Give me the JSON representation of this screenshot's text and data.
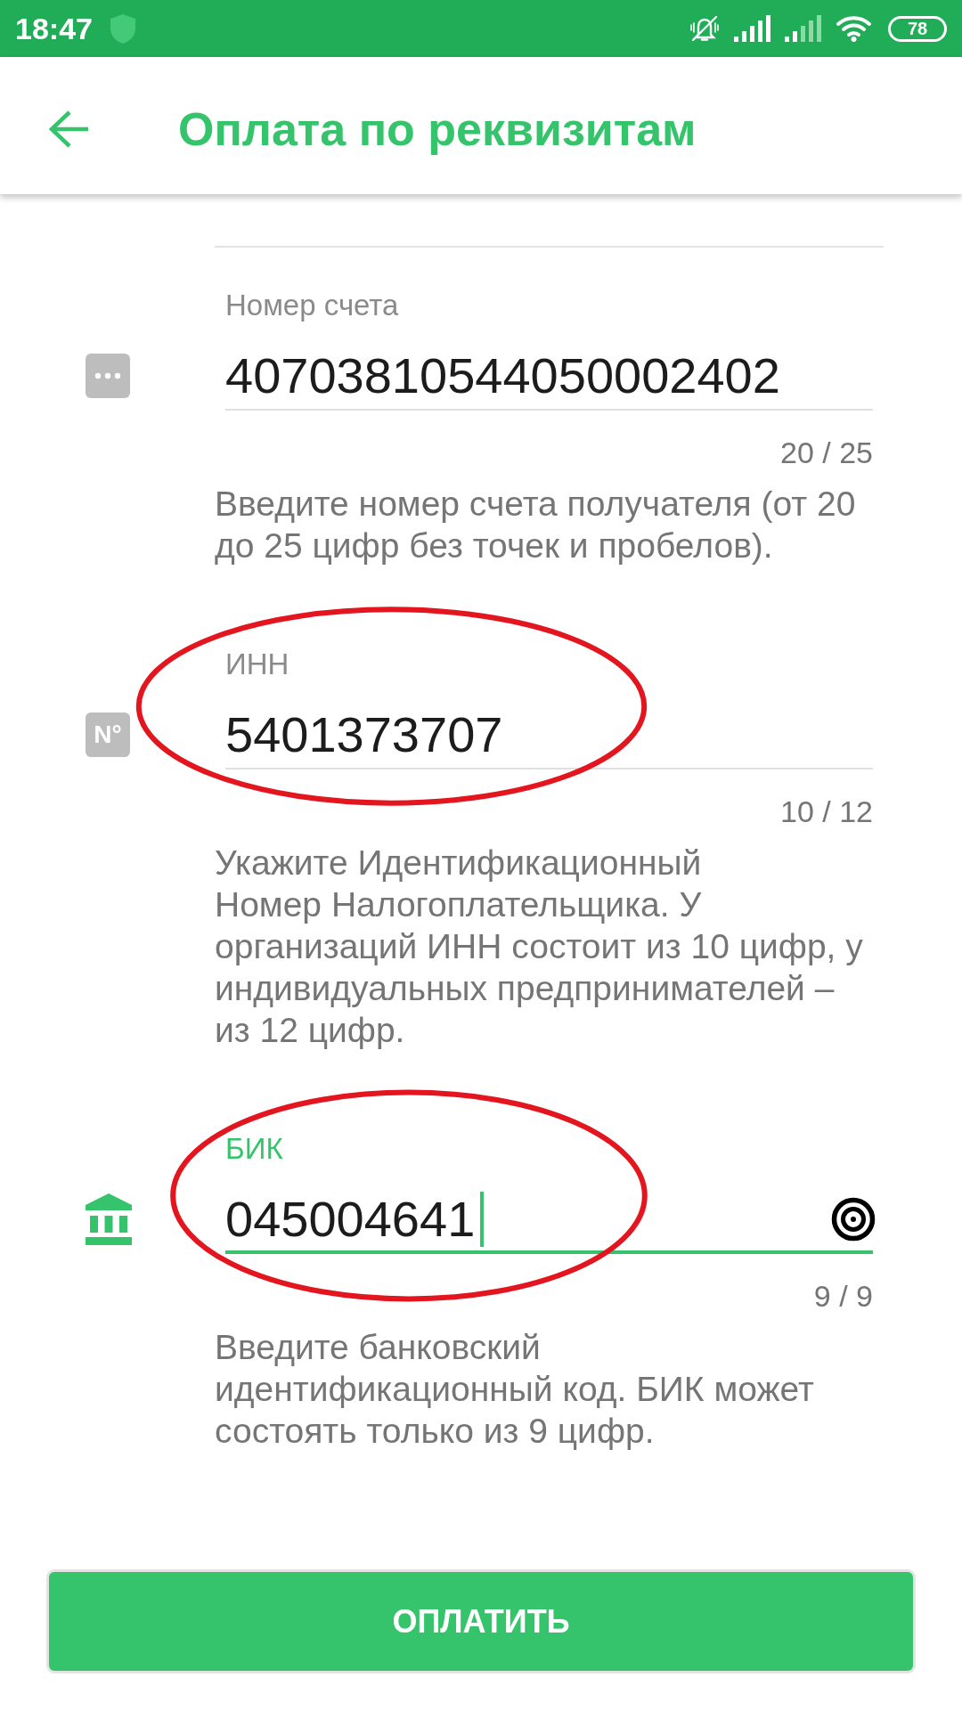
{
  "status_bar": {
    "time": "18:47",
    "battery": "78"
  },
  "header": {
    "title": "Оплата по реквизитам"
  },
  "fields": [
    {
      "kind": "account",
      "label": "Номер счета",
      "value": "40703810544050002402",
      "counter": "20 / 25",
      "hint": "Введите номер счета получателя (от 20\nдо 25 цифр без точек и пробелов).",
      "focused": false,
      "circled": false
    },
    {
      "kind": "inn",
      "icon_text": "N°",
      "label": "ИНН",
      "value": "5401373707",
      "counter": "10 / 12",
      "hint": "Укажите Идентификационный\nНомер Налогоплательщика. У\nорганизаций ИНН состоит из 10 цифр, у\nиндивидуальных предпринимателей –\nиз 12 цифр.",
      "focused": false,
      "circled": true
    },
    {
      "kind": "bik",
      "label": "БИК",
      "value": "045004641",
      "counter": "9 / 9",
      "hint": "Введите банковский\nидентификационный код. БИК может\nсостоять только из 9 цифр.",
      "focused": true,
      "circled": true
    }
  ],
  "pay_button": {
    "label": "ОПЛАТИТЬ"
  }
}
